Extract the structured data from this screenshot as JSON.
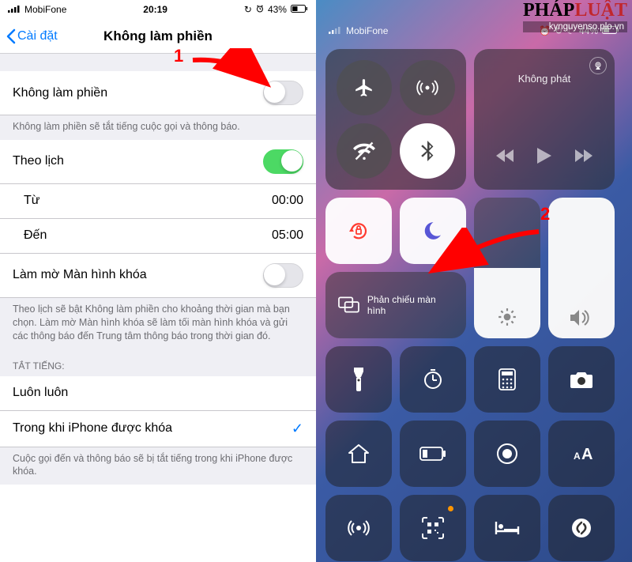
{
  "watermark": {
    "brand1": "PHÁP",
    "brand2": "LUẬT",
    "sub": "kynguyenso.plo.vn"
  },
  "annotations": {
    "num1": "1",
    "num2": "2"
  },
  "left": {
    "status": {
      "carrier": "MobiFone",
      "time": "20:19",
      "battery": "43%"
    },
    "nav": {
      "back": "Cài đặt",
      "title": "Không làm phiền"
    },
    "dnd": {
      "label": "Không làm phiền",
      "desc": "Không làm phiền sẽ tắt tiếng cuộc gọi và thông báo."
    },
    "schedule": {
      "label": "Theo lịch"
    },
    "from": {
      "label": "Từ",
      "value": "00:00"
    },
    "to": {
      "label": "Đến",
      "value": "05:00"
    },
    "dim": {
      "label": "Làm mờ Màn hình khóa",
      "desc": "Theo lịch sẽ bật Không làm phiền cho khoảng thời gian mà bạn chọn. Làm mờ Màn hình khóa sẽ làm tối màn hình khóa và gửi các thông báo đến Trung tâm thông báo trong thời gian đó."
    },
    "silence": {
      "header": "TẮT TIẾNG:",
      "always": "Luôn luôn",
      "locked": "Trong khi iPhone được khóa",
      "desc": "Cuộc gọi đến và thông báo sẽ bị tắt tiếng trong khi iPhone được khóa."
    }
  },
  "right": {
    "status": {
      "carrier": "MobiFone",
      "battery": "44%"
    },
    "media": {
      "title": "Không phát"
    },
    "mirror": {
      "label": "Phản chiếu màn hình"
    }
  }
}
